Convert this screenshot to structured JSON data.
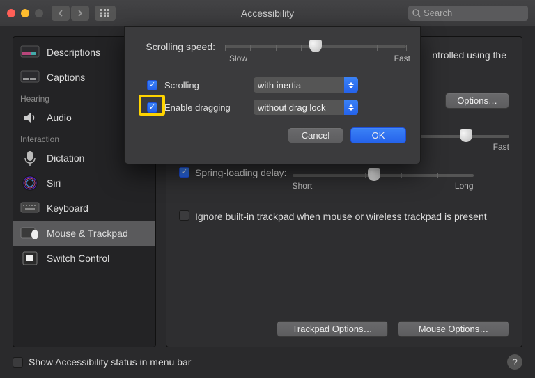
{
  "window": {
    "title": "Accessibility",
    "search_placeholder": "Search"
  },
  "sidebar": {
    "items": [
      {
        "label": "Descriptions"
      },
      {
        "label": "Captions"
      }
    ],
    "hearing_header": "Hearing",
    "hearing": [
      {
        "label": "Audio"
      }
    ],
    "interaction_header": "Interaction",
    "interaction": [
      {
        "label": "Dictation"
      },
      {
        "label": "Siri"
      },
      {
        "label": "Keyboard"
      },
      {
        "label": "Mouse & Trackpad"
      },
      {
        "label": "Switch Control"
      }
    ]
  },
  "main": {
    "intro_tail": "ntrolled using the",
    "options_button": "Options…",
    "slider2": {
      "right_label": "Fast"
    },
    "spring": {
      "label": "Spring-loading delay:",
      "checked": true,
      "short": "Short",
      "long": "Long"
    },
    "ignore": {
      "label": "Ignore built-in trackpad when mouse or wireless trackpad is present",
      "checked": false
    },
    "trackpad_options": "Trackpad Options…",
    "mouse_options": "Mouse Options…"
  },
  "sheet": {
    "scrolling_speed_label": "Scrolling speed:",
    "slow": "Slow",
    "fast": "Fast",
    "scrolling": {
      "label": "Scrolling",
      "checked": true,
      "select": "with inertia"
    },
    "dragging": {
      "label": "Enable dragging",
      "checked": true,
      "select": "without drag lock"
    },
    "cancel": "Cancel",
    "ok": "OK"
  },
  "footer": {
    "checkbox_label": "Show Accessibility status in menu bar",
    "checked": false,
    "help": "?"
  }
}
